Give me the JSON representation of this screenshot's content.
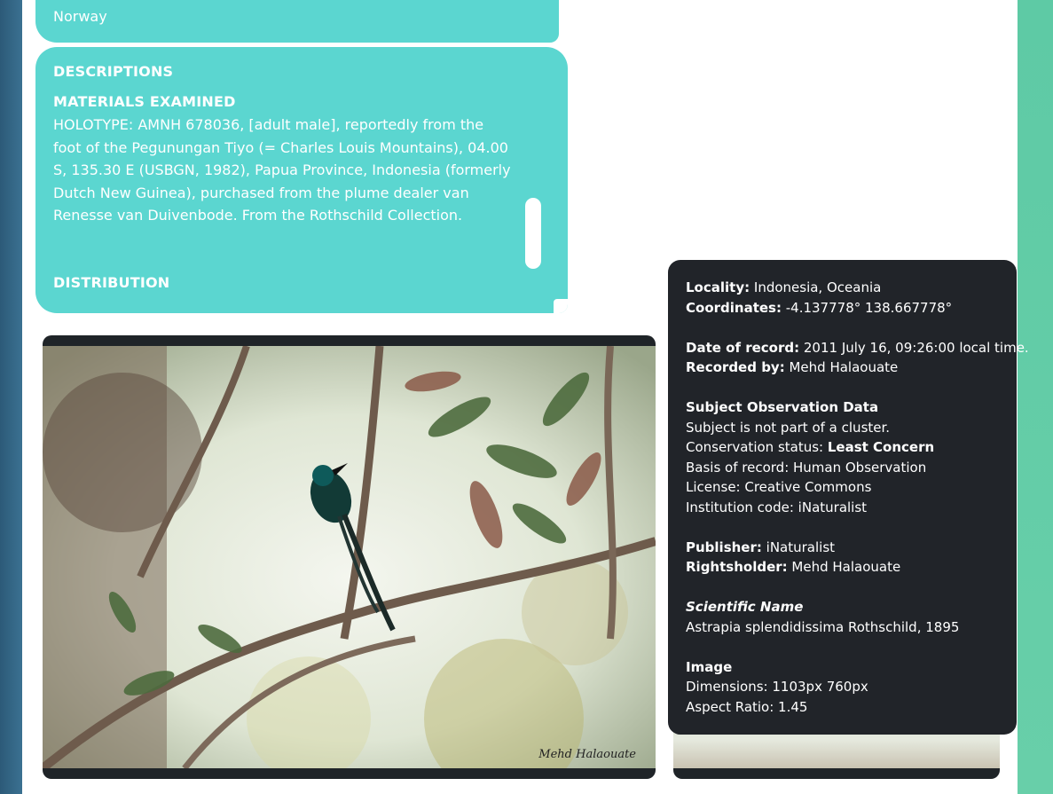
{
  "location_card": {
    "country": "Norway"
  },
  "descriptions_card": {
    "heading": "DESCRIPTIONS",
    "materials_heading": "MATERIALS EXAMINED",
    "materials_text": "HOLOTYPE: AMNH 678036, [adult male], reportedly from the foot of the Pegunungan Tiyo (= Charles Louis Mountains), 04.00 S, 135.30 E (USBGN, 1982), Papua Province, Indonesia (formerly Dutch New Guinea), purchased from the plume dealer van Renesse van Duivenbode. From the Rothschild Collection.",
    "distribution_heading": "DISTRIBUTION"
  },
  "photo": {
    "watermark": "Mehd Halaouate"
  },
  "tooltip": {
    "locality_label": "Locality:",
    "locality_value": "Indonesia, Oceania",
    "coordinates_label": "Coordinates:",
    "coordinates_value": "-4.137778° 138.667778°",
    "date_label": "Date of record:",
    "date_value": "2011 July 16, 09:26:00 local time.",
    "recorded_by_label": "Recorded by:",
    "recorded_by_value": "Mehd Halaouate",
    "subject_heading": "Subject Observation Data",
    "cluster_text": "Subject is not part of a cluster.",
    "conservation_label": "Conservation status:",
    "conservation_value": "Least Concern",
    "basis_text": "Basis of record: Human Observation",
    "license_text": "License: Creative Commons",
    "institution_text": "Institution code: iNaturalist",
    "publisher_label": "Publisher:",
    "publisher_value": "iNaturalist",
    "rightsholder_label": "Rightsholder:",
    "rightsholder_value": "Mehd Halaouate",
    "scientific_name_heading": "Scientific Name",
    "scientific_name_value": "Astrapia splendidissima Rothschild, 1895",
    "image_heading": "Image",
    "dimensions_text": "Dimensions: 1103px 760px",
    "aspect_ratio_text": "Aspect Ratio: 1.45"
  },
  "colors": {
    "card_teal": "#5bd6d0",
    "tooltip_bg": "#212429",
    "page_bg": "#ffffff"
  }
}
